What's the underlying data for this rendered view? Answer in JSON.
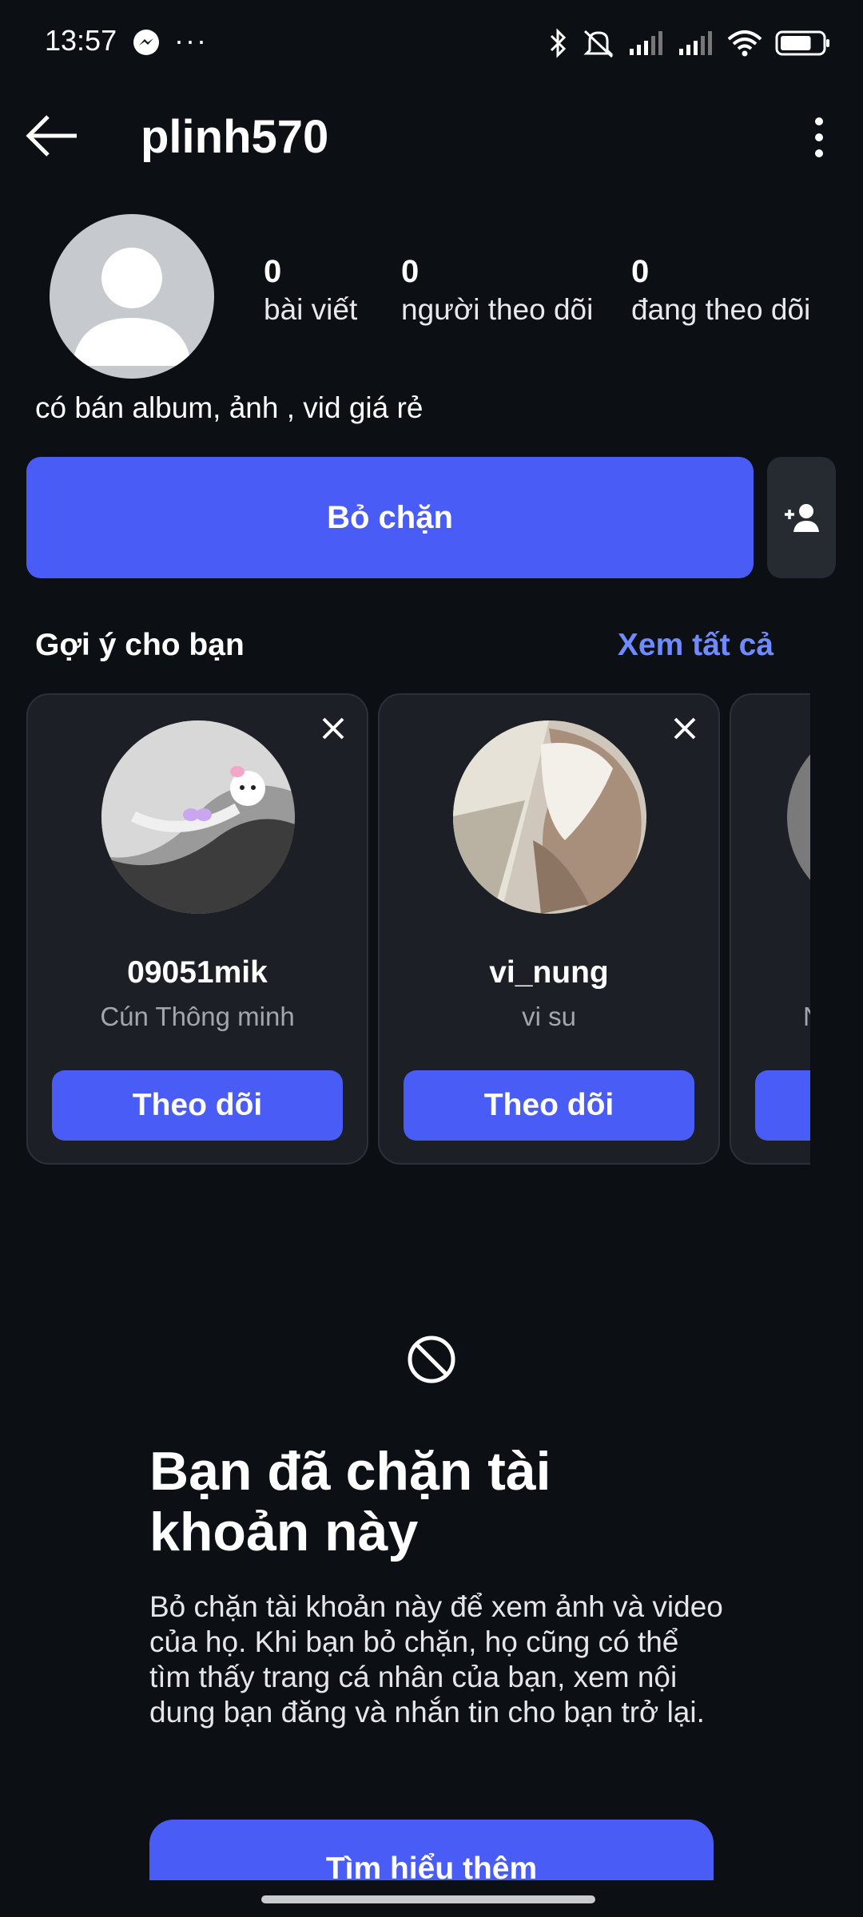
{
  "status_bar": {
    "time": "13:57",
    "left_icons": [
      "messenger-icon",
      "more-dots-icon"
    ],
    "right_icons": [
      "bluetooth-icon",
      "mute-icon",
      "signal-icon",
      "signal-icon",
      "wifi-icon",
      "battery-icon"
    ],
    "battery_level": 0.75
  },
  "header": {
    "username": "plinh570"
  },
  "profile": {
    "stats": [
      {
        "count": "0",
        "label": "bài viết"
      },
      {
        "count": "0",
        "label": "người theo dõi"
      },
      {
        "count": "0",
        "label": "đang theo dõi"
      }
    ],
    "bio": "có bán album, ảnh , vid giá rẻ",
    "unblock_label": "Bỏ chặn"
  },
  "suggestions": {
    "title": "Gợi ý cho bạn",
    "see_all": "Xem tất cả",
    "cards": [
      {
        "username": "09051mik",
        "subtitle": "Cún Thông minh",
        "follow_label": "Theo dõi"
      },
      {
        "username": "vi_nung",
        "subtitle": "vi su",
        "follow_label": "Theo dõi"
      },
      {
        "username": "",
        "subtitle": "N",
        "follow_label": ""
      }
    ]
  },
  "blocked": {
    "title": "Bạn đã chặn tài khoản này",
    "description": "Bỏ chặn tài khoản này để xem ảnh và video của họ. Khi bạn bỏ chặn, họ cũng có thể tìm thấy trang cá nhân của bạn, xem nội dung bạn đăng và nhắn tin cho bạn trở lại.",
    "learn_more": "Tìm hiểu thêm"
  },
  "colors": {
    "background": "#0c0f14",
    "accent": "#4a5cf6",
    "link": "#6f8bff",
    "card": "#1c1f26"
  }
}
